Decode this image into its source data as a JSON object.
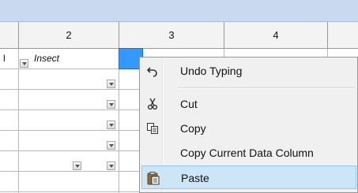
{
  "grid": {
    "column_headers": [
      "2",
      "3",
      "4"
    ],
    "row1": {
      "prefix": "l",
      "value": "Insect"
    }
  },
  "context_menu": {
    "items": [
      {
        "label": "Undo Typing",
        "icon": "undo-icon"
      },
      {
        "label": "Cut",
        "icon": "scissors-icon"
      },
      {
        "label": "Copy",
        "icon": "copy-icon"
      },
      {
        "label": "Copy Current Data Column",
        "icon": ""
      },
      {
        "label": "Paste",
        "icon": "clipboard-icon",
        "highlighted": true
      }
    ]
  },
  "colors": {
    "top_bar": "#c9d9ef",
    "selected_cell": "#3399ff",
    "menu_background": "#f0f0f0",
    "menu_highlight": "#cde6f7"
  }
}
